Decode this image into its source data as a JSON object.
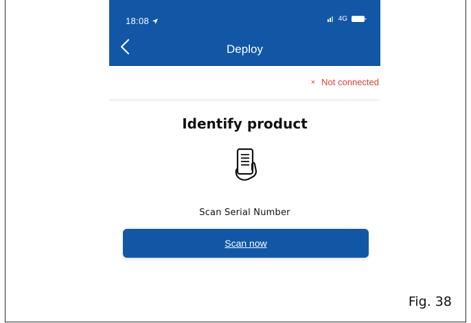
{
  "status_bar": {
    "time": "18:08",
    "network": "4G",
    "icons": [
      "location-arrow-icon",
      "signal-icon",
      "battery-icon"
    ]
  },
  "nav": {
    "title": "Deploy",
    "back_icon": "chevron-left-icon"
  },
  "connection": {
    "status": "Not connected",
    "symbol": "×",
    "color": "#e23a2f"
  },
  "main": {
    "heading": "Identify product",
    "scan_label": "Scan Serial Number",
    "scan_icon": "hand-phone-scan-icon",
    "button_label": "Scan now"
  },
  "caption": "Fig. 38",
  "colors": {
    "brand": "#1157a6",
    "error": "#e23a2f",
    "text": "#111111",
    "background": "#ffffff"
  }
}
